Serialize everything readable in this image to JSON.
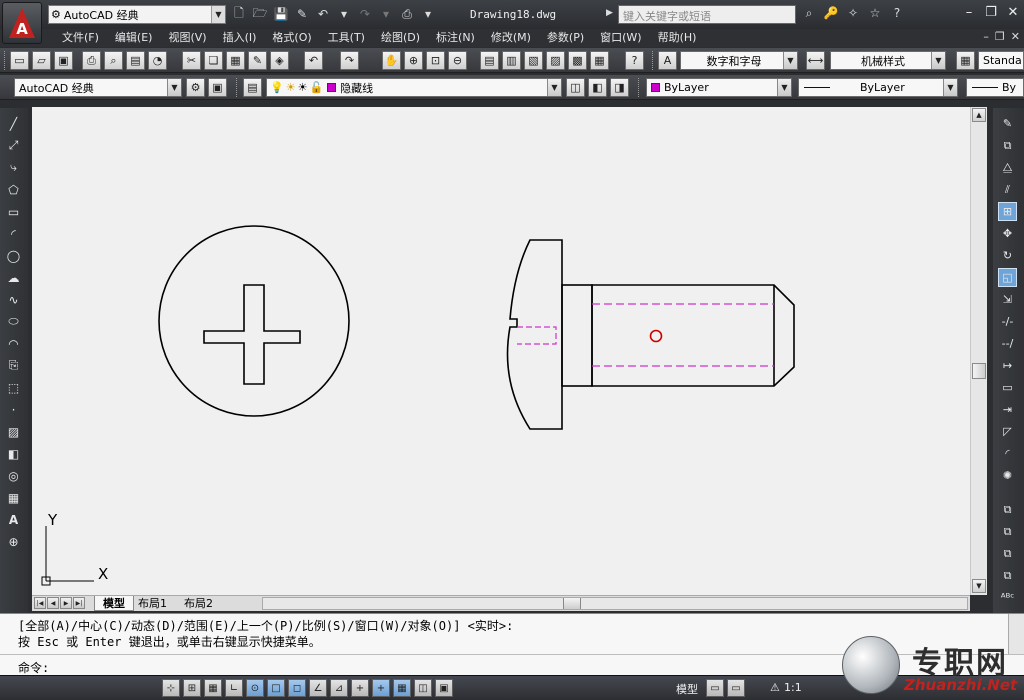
{
  "title_bar": {
    "workspace": "AutoCAD 经典",
    "document_title": "Drawing18.dwg",
    "search_placeholder": "键入关键字或短语"
  },
  "menu": [
    "文件(F)",
    "编辑(E)",
    "视图(V)",
    "插入(I)",
    "格式(O)",
    "工具(T)",
    "绘图(D)",
    "标注(N)",
    "修改(M)",
    "参数(P)",
    "窗口(W)",
    "帮助(H)"
  ],
  "toolbar1": {
    "text_style": "数字和字母",
    "dim_style": "机械样式",
    "table_style": "Standa"
  },
  "toolbar2": {
    "workspace": "AutoCAD 经典",
    "layer": "隐藏线",
    "layer_color": "#cc00cc",
    "color": "ByLayer",
    "color_swatch": "#cc00cc",
    "linetype": "ByLayer",
    "lineweight": "By"
  },
  "drawing": {
    "ucs_x": "X",
    "ucs_y": "Y",
    "line_color": "#000000",
    "hidden_color": "#cc33cc",
    "center_color": "#cc0000",
    "background": "#f0f0f0"
  },
  "layout_tabs": [
    "模型",
    "布局1",
    "布局2"
  ],
  "command": {
    "line1": "[全部(A)/中心(C)/动态(D)/范围(E)/上一个(P)/比例(S)/窗口(W)/对象(O)] <实时>:",
    "line2": "按 Esc 或 Enter 键退出，或单击右键显示快捷菜单。",
    "prompt": "命令:"
  },
  "status": {
    "space": "模型",
    "scale": "1:1"
  },
  "watermark": {
    "name": "专职网",
    "url": "Zhuanzhi.Net"
  }
}
